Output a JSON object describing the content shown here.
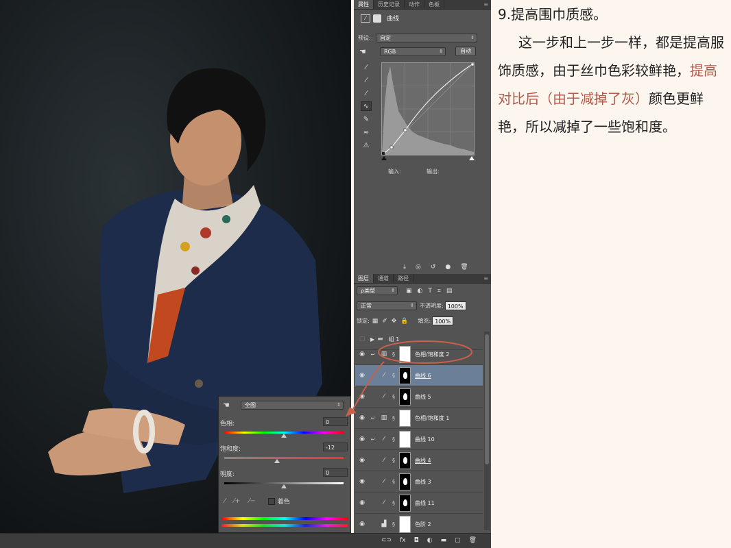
{
  "properties_panel": {
    "tabs": [
      "属性",
      "历史记录",
      "动作",
      "色板"
    ],
    "title": "曲线",
    "preset_label": "预设:",
    "preset_value": "自定",
    "channel_value": "RGB",
    "auto_button": "自动",
    "input_label": "输入:",
    "output_label": "输出:"
  },
  "layers_panel": {
    "tabs": [
      "图层",
      "通道",
      "路径"
    ],
    "filter_value": "ρ类型",
    "blend_mode": "正常",
    "opacity_label": "不透明度:",
    "opacity_value": "100%",
    "lock_label": "锁定:",
    "fill_label": "填充:",
    "fill_value": "100%",
    "group_name": "组 1",
    "layers": [
      {
        "name": "色相/饱和度 2"
      },
      {
        "name": "曲线 6"
      },
      {
        "name": "曲线 5"
      },
      {
        "name": "色相/饱和度 1"
      },
      {
        "name": "曲线 10"
      },
      {
        "name": "曲线 4"
      },
      {
        "name": "曲线 3"
      },
      {
        "name": "曲线 11"
      },
      {
        "name": "色阶 2"
      }
    ]
  },
  "huesat_panel": {
    "range_value": "全图",
    "hue_label": "色相:",
    "hue_value": "0",
    "hue_level": 0,
    "saturation_label": "饱和度:",
    "saturation_value": "-12",
    "saturation_level": -12,
    "lightness_label": "明度:",
    "lightness_value": "0",
    "lightness_level": 0,
    "colorize_label": "着色"
  },
  "article": {
    "heading": "9.提高围巾质感。",
    "para_1": "这一步和上一步一样，都是提高服饰质感，由于丝巾色彩较鲜艳，",
    "para_highlight": "提高对比后（由于减掉了灰）",
    "para_2": "颜色更鲜艳，所以减掉了一些饱和度。"
  },
  "colors": {
    "highlight": "#b45b4a",
    "selected_layer": "#6b7f98",
    "annotation": "#c9604a"
  }
}
